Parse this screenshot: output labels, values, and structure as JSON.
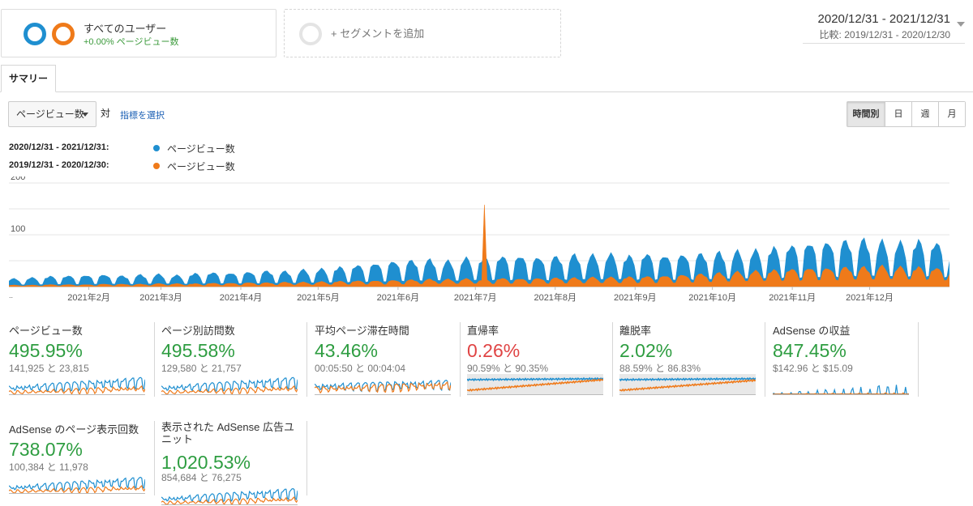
{
  "segments": {
    "all_users": {
      "name": "すべてのユーザー",
      "sub": "+0.00% ページビュー数"
    },
    "add_segment": "+ セグメントを追加"
  },
  "date": {
    "range": "2020/12/31 - 2021/12/31",
    "compare": "比較: 2019/12/31 - 2020/12/30"
  },
  "tabs": {
    "summary": "サマリー"
  },
  "controls": {
    "metric": "ページビュー数",
    "vs": "対",
    "select_metric": "指標を選択",
    "time_buttons": [
      "時間別",
      "日",
      "週",
      "月"
    ],
    "active_time": "時間別"
  },
  "legend": {
    "current_range": "2020/12/31 - 2021/12/31:",
    "current_label": "ページビュー数",
    "previous_range": "2019/12/31 - 2020/12/30:",
    "previous_label": "ページビュー数"
  },
  "colors": {
    "current": "#1f8fd0",
    "previous": "#ef7a1a",
    "positive": "#2e9d41",
    "negative": "#e04444"
  },
  "chart_data": {
    "type": "area",
    "y_ticks": [
      "200",
      "100"
    ],
    "ylim": [
      0,
      200
    ],
    "x_labels": [
      "2021年2月",
      "2021年3月",
      "2021年4月",
      "2021年5月",
      "2021年6月",
      "2021年7月",
      "2021年8月",
      "2021年9月",
      "2021年10月",
      "2021年11月",
      "2021年12月"
    ],
    "x_start_label": "..",
    "grid": true,
    "series": [
      {
        "name": "2020/12/31 - 2021/12/31: ページビュー数",
        "color": "#1f8fd0",
        "weekly_peak": [
          16,
          18,
          21,
          22,
          23,
          24,
          22,
          24,
          25,
          23,
          27,
          29,
          28,
          30,
          32,
          31,
          34,
          36,
          40,
          44,
          48,
          52,
          54,
          55,
          52,
          58,
          60,
          62,
          63,
          60,
          62,
          65,
          64,
          66,
          63,
          67,
          64,
          66,
          68,
          70,
          72,
          74,
          80,
          85,
          90,
          92,
          95,
          96,
          92,
          90,
          94,
          90,
          62
        ]
      },
      {
        "name": "2019/12/31 - 2020/12/30: ページビュー数",
        "color": "#ef7a1a",
        "weekly_peak": [
          3,
          3,
          4,
          4,
          4,
          5,
          5,
          5,
          6,
          6,
          6,
          7,
          7,
          8,
          8,
          9,
          9,
          10,
          11,
          12,
          12,
          13,
          14,
          15,
          15,
          16,
          15,
          17,
          16,
          17,
          18,
          18,
          19,
          19,
          20,
          21,
          22,
          24,
          26,
          28,
          30,
          32,
          34,
          36,
          38,
          38,
          40,
          40,
          42,
          40,
          40,
          38,
          30
        ],
        "spike": {
          "week": 26,
          "value": 158
        }
      }
    ]
  },
  "scorecards": [
    {
      "title": "ページビュー数",
      "value": "495.95%",
      "sub": "141,925 と 23,815",
      "positive": true
    },
    {
      "title": "ページ別訪問数",
      "value": "495.58%",
      "sub": "129,580 と 21,757",
      "positive": true
    },
    {
      "title": "平均ページ滞在時間",
      "value": "43.46%",
      "sub": "00:05:50 と 00:04:04",
      "positive": true
    },
    {
      "title": "直帰率",
      "value": "0.26%",
      "sub": "90.59% と 90.35%",
      "positive": false
    },
    {
      "title": "離脱率",
      "value": "2.02%",
      "sub": "88.59% と 86.83%",
      "positive": true
    },
    {
      "title": "AdSense の収益",
      "value": "847.45%",
      "sub": "$142.96 と $15.09",
      "positive": true
    },
    {
      "title": "AdSense のページ表示回数",
      "value": "738.07%",
      "sub": "100,384 と 11,978",
      "positive": true
    },
    {
      "title": "表示された AdSense 広告ユニット",
      "value": "1,020.53%",
      "sub": "854,684 と 76,275",
      "positive": true
    }
  ]
}
